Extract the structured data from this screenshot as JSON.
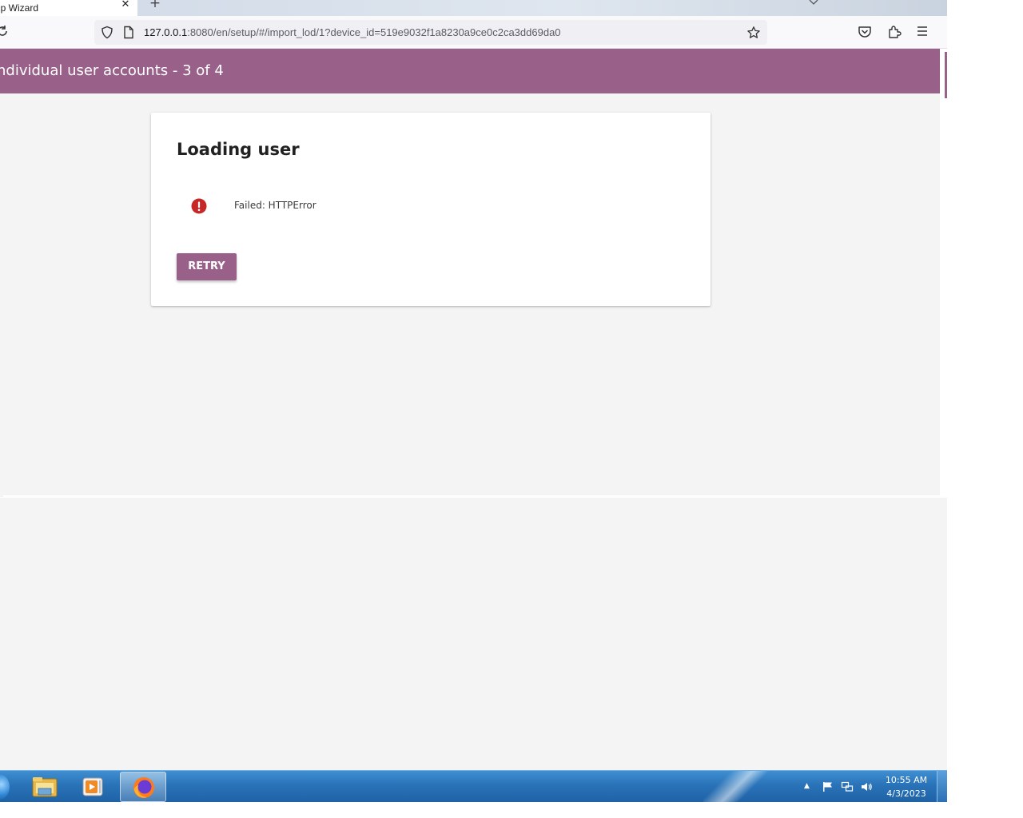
{
  "browser": {
    "tab_title": "up Wizard",
    "tab_close": "✕",
    "new_tab": "+",
    "url_host": "127.0.0.1",
    "url_rest": ":8080/en/setup/#/import_lod/1?device_id=519e9032f1a8230a9ce0c2ca3dd69da0"
  },
  "app": {
    "header_title": "ndividual user accounts - 3 of 4",
    "header_color": "#996189"
  },
  "card": {
    "title": "Loading user",
    "error_message": "Failed: HTTPError",
    "retry_label": "RETRY",
    "error_color": "#c62828"
  },
  "taskbar": {
    "apps": [
      "explorer-icon",
      "media-player-icon",
      "firefox-icon"
    ],
    "time": "10:55 AM",
    "date": "4/3/2023"
  }
}
